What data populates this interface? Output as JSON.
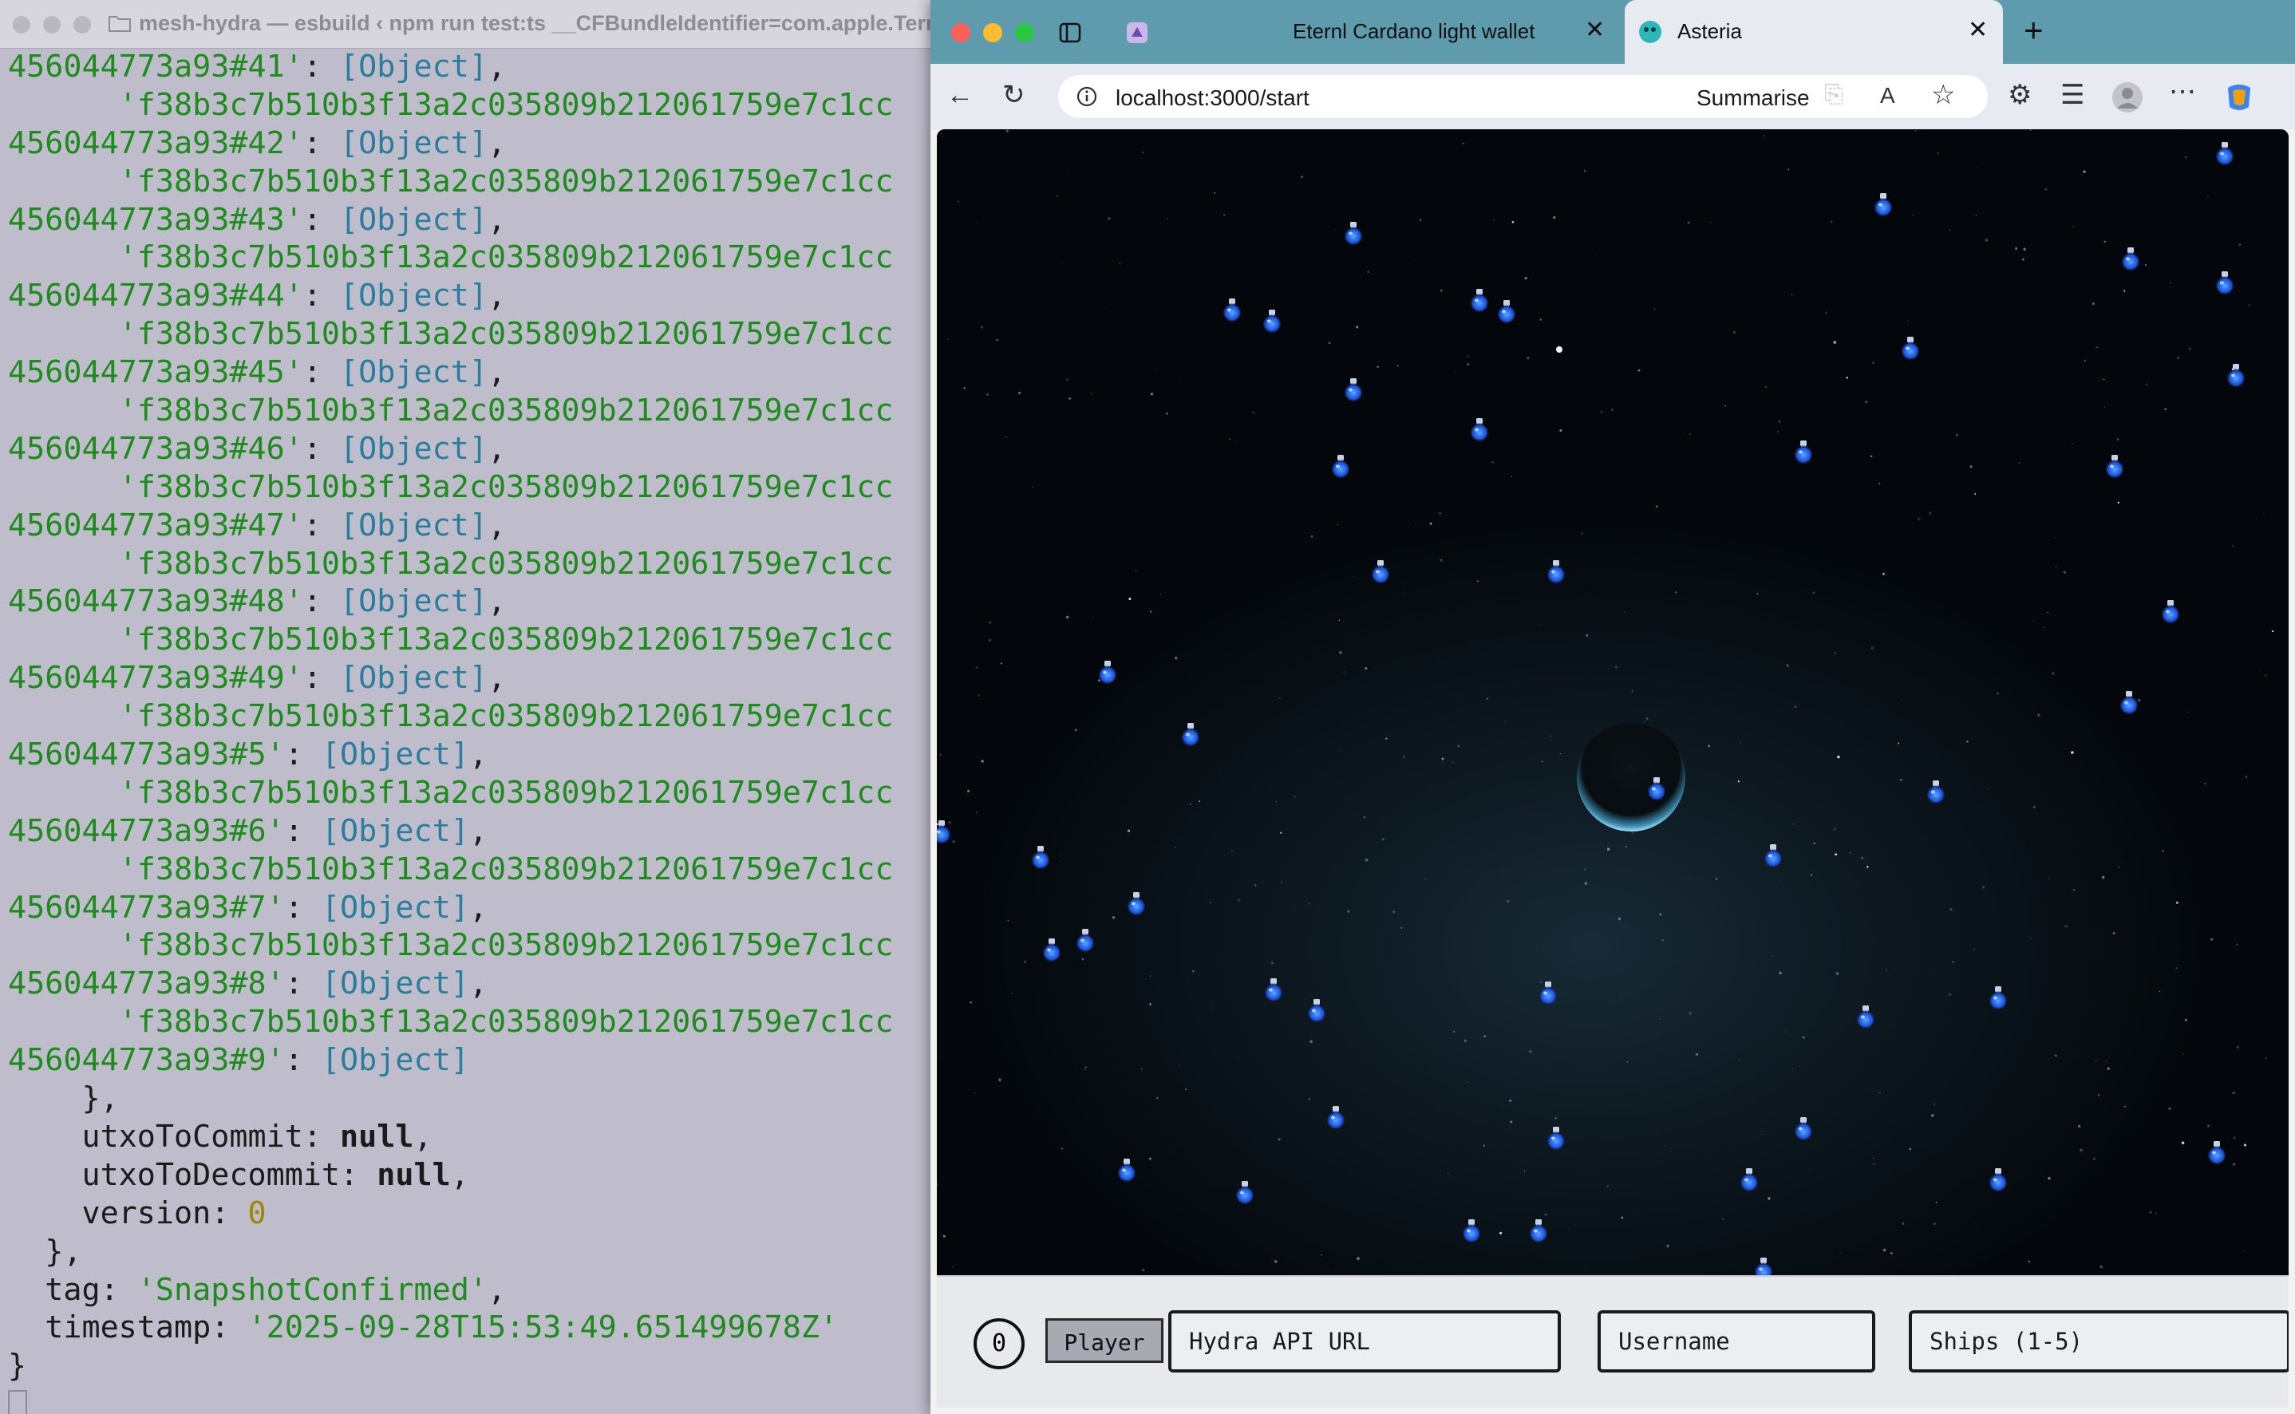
{
  "terminal": {
    "title": "mesh-hydra — esbuild ‹ npm run test:ts __CFBundleIdentifier=com.apple.Term",
    "entries": [
      {
        "key_prefix": "456044773a93#41'",
        "value": "[Object]",
        "sep": ",",
        "next_hash": "'f38b3c7b510b3f13a2c035809b212061759e7c1cc"
      },
      {
        "key_prefix": "456044773a93#42'",
        "value": "[Object]",
        "sep": ",",
        "next_hash": "'f38b3c7b510b3f13a2c035809b212061759e7c1cc"
      },
      {
        "key_prefix": "456044773a93#43'",
        "value": "[Object]",
        "sep": ",",
        "next_hash": "'f38b3c7b510b3f13a2c035809b212061759e7c1cc"
      },
      {
        "key_prefix": "456044773a93#44'",
        "value": "[Object]",
        "sep": ",",
        "next_hash": "'f38b3c7b510b3f13a2c035809b212061759e7c1cc"
      },
      {
        "key_prefix": "456044773a93#45'",
        "value": "[Object]",
        "sep": ",",
        "next_hash": "'f38b3c7b510b3f13a2c035809b212061759e7c1cc"
      },
      {
        "key_prefix": "456044773a93#46'",
        "value": "[Object]",
        "sep": ",",
        "next_hash": "'f38b3c7b510b3f13a2c035809b212061759e7c1cc"
      },
      {
        "key_prefix": "456044773a93#47'",
        "value": "[Object]",
        "sep": ",",
        "next_hash": "'f38b3c7b510b3f13a2c035809b212061759e7c1cc"
      },
      {
        "key_prefix": "456044773a93#48'",
        "value": "[Object]",
        "sep": ",",
        "next_hash": "'f38b3c7b510b3f13a2c035809b212061759e7c1cc"
      },
      {
        "key_prefix": "456044773a93#49'",
        "value": "[Object]",
        "sep": ",",
        "next_hash": "'f38b3c7b510b3f13a2c035809b212061759e7c1cc"
      },
      {
        "key_prefix": "456044773a93#5'",
        "value": "[Object]",
        "sep": ",",
        "next_hash": "'f38b3c7b510b3f13a2c035809b212061759e7c1cc"
      },
      {
        "key_prefix": "456044773a93#6'",
        "value": "[Object]",
        "sep": ",",
        "next_hash": "'f38b3c7b510b3f13a2c035809b212061759e7c1cc"
      },
      {
        "key_prefix": "456044773a93#7'",
        "value": "[Object]",
        "sep": ",",
        "next_hash": "'f38b3c7b510b3f13a2c035809b212061759e7c1cc"
      },
      {
        "key_prefix": "456044773a93#8'",
        "value": "[Object]",
        "sep": ",",
        "next_hash": "'f38b3c7b510b3f13a2c035809b212061759e7c1cc"
      },
      {
        "key_prefix": "456044773a93#9'",
        "value": "[Object]",
        "sep": "",
        "next_hash": ""
      }
    ],
    "tail": {
      "close_inner": "},",
      "utxo_commit_key": "utxoToCommit",
      "utxo_commit_val": "null",
      "utxo_decommit_key": "utxoToDecommit",
      "utxo_decommit_val": "null",
      "version_key": "version",
      "version_val": "0",
      "close_outer": "},",
      "tag_key": "tag",
      "tag_val": "'SnapshotConfirmed'",
      "timestamp_key": "timestamp",
      "timestamp_val": "'2025-09-28T15:53:49.651499678Z'",
      "close_root": "}"
    }
  },
  "browser": {
    "tabs": [
      {
        "label": "Eternl Cardano light wallet",
        "icon": "eternl-icon",
        "active": false
      },
      {
        "label": "Asteria",
        "icon": "asteria-icon",
        "active": true
      }
    ],
    "new_tab_symbol": "+",
    "close_symbol": "✕",
    "url": "localhost:3000/start",
    "summarise_label": "Summarise",
    "tabstrip_color": "#5e9cad"
  },
  "game": {
    "score": "0",
    "player_button": "Player",
    "hydra_api_placeholder": "Hydra API URL",
    "username_placeholder": "Username",
    "ships_placeholder": "Ships (1-5)",
    "fuel_icon": "fuel-potion-icon",
    "planet_icon": "asteria-planet"
  }
}
